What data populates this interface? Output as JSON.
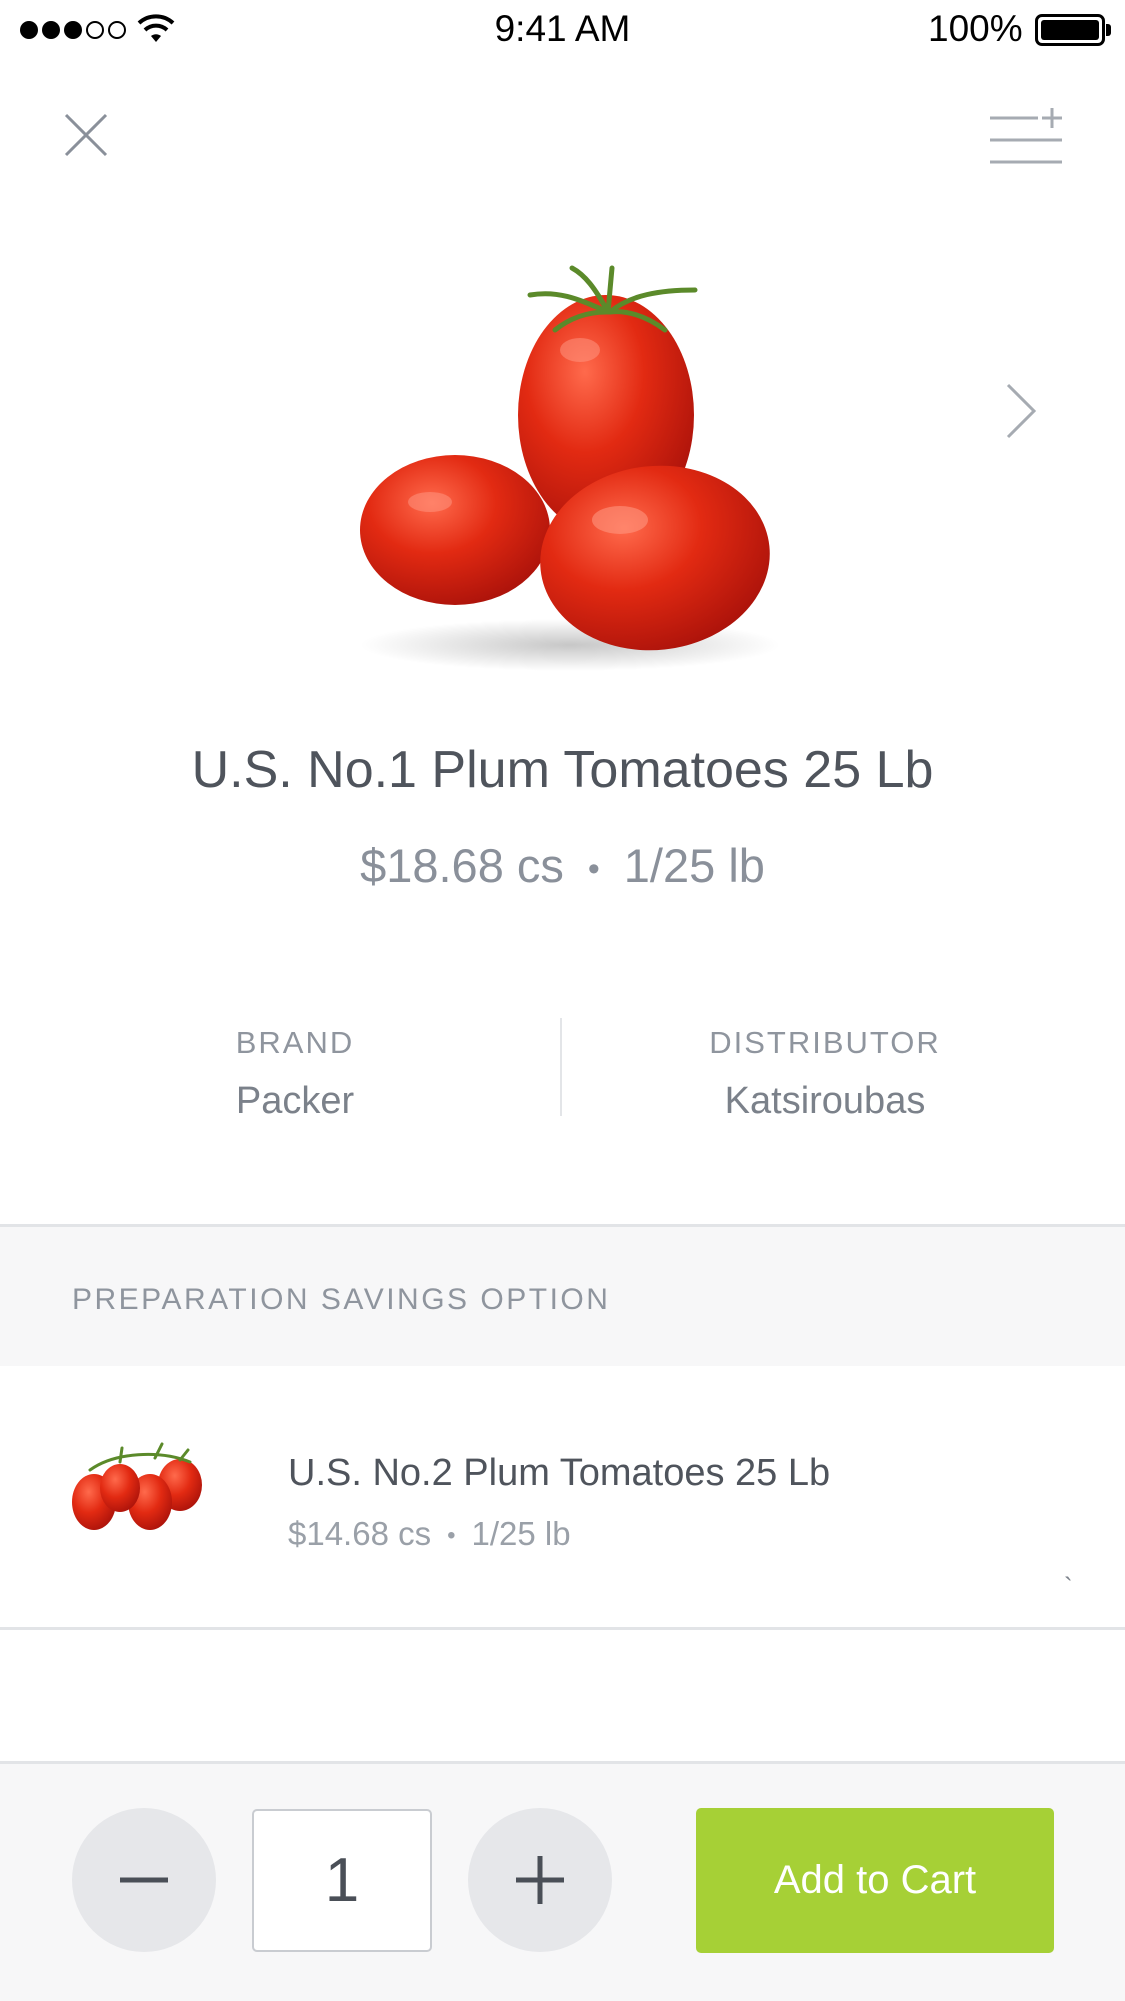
{
  "status_bar": {
    "time": "9:41 AM",
    "battery": "100%"
  },
  "product": {
    "title": "U.S. No.1 Plum Tomatoes 25 Lb",
    "price": "$18.68 cs",
    "separator": "•",
    "pack": "1/25 lb",
    "brand_label": "BRAND",
    "brand": "Packer",
    "distributor_label": "DISTRIBUTOR",
    "distributor": "Katsiroubas"
  },
  "savings": {
    "section_title": "PREPARATION SAVINGS OPTION",
    "option_title": "U.S. No.2 Plum Tomatoes 25 Lb",
    "option_price": "$14.68 cs",
    "option_separator": "•",
    "option_pack": "1/25 lb",
    "option_tick": "`"
  },
  "cart": {
    "quantity": "1",
    "add_label": "Add to Cart"
  },
  "colors": {
    "accent": "#a6d036",
    "tomato": "#e02a12",
    "stem": "#5b8a2a"
  }
}
